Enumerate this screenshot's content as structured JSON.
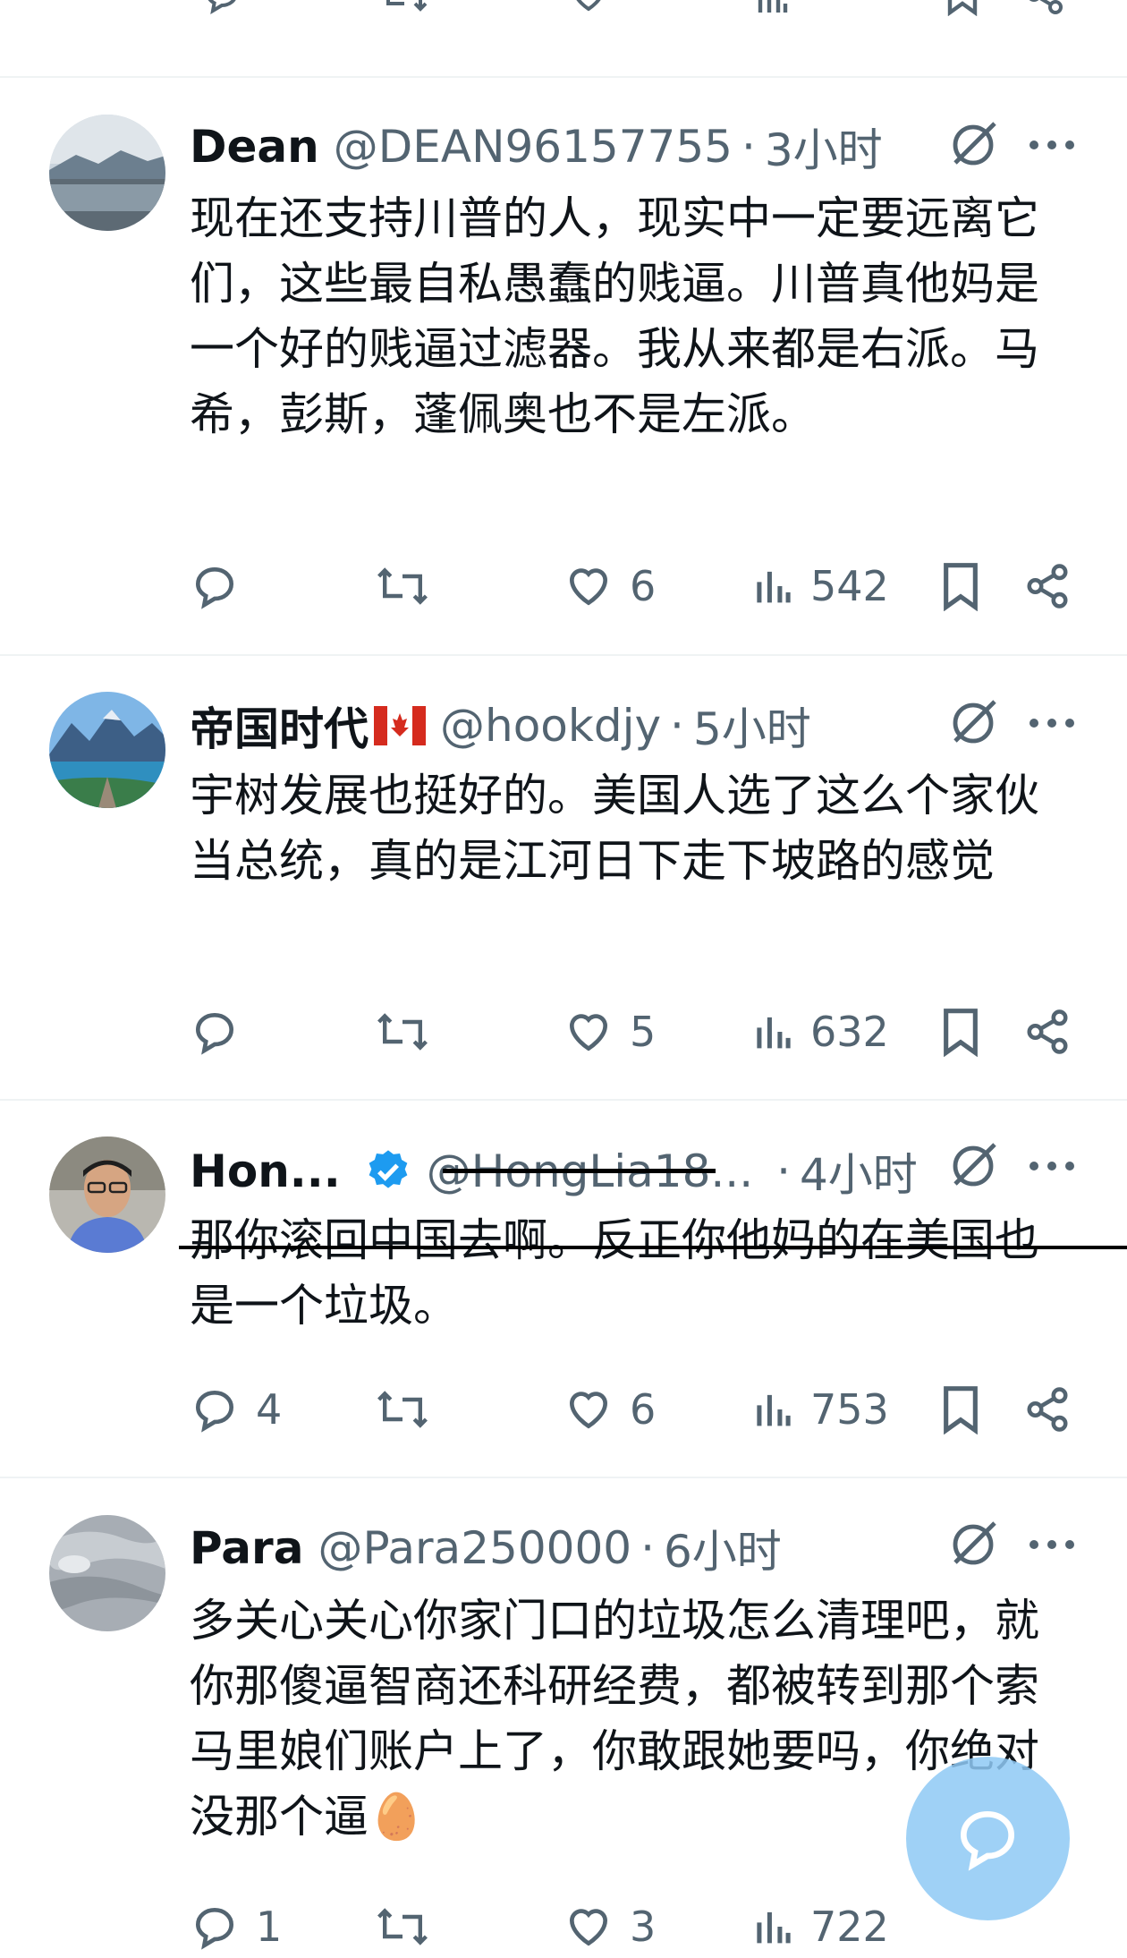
{
  "tweets": [
    {
      "name": "Dean",
      "handle": "@DEAN96157755",
      "dot": "·",
      "time": "3小时",
      "text": "现在还支持川普的人，现实中一定要远离它们，这些最自私愚蠢的贱逼。川普真他妈是一个好的贱逼过滤器。我从来都是右派。马希，彭斯，蓬佩奥也不是左派。",
      "replies": "",
      "likes": "6",
      "views": "542"
    },
    {
      "name": "帝国时代",
      "handle": "@hookdjy",
      "dot": "·",
      "time": "5小时",
      "text": "宇树发展也挺好的。美国人选了这么个家伙当总统，真的是江河日下走下坡路的感觉",
      "replies": "",
      "likes": "5",
      "views": "632"
    },
    {
      "name": "Hon...",
      "handle": "@HongLia18...",
      "dot": "·",
      "time": "4小时",
      "text": "那你滚回中国去啊。反正你他妈的在美国也是一个垃圾。",
      "replies": "4",
      "likes": "6",
      "views": "753"
    },
    {
      "name": "Para",
      "handle": "@Para250000",
      "dot": "·",
      "time": "6小时",
      "text": "多关心关心你家门口的垃圾怎么清理吧，就你那傻逼智商还科研经费，都被转到那个索马里娘们账户上了，你敢跟她要吗，你绝对没那个逼🥚",
      "replies": "1",
      "likes": "3",
      "views": "722"
    }
  ],
  "colors": {
    "text": "#0f1419",
    "secondary": "#536471",
    "divider": "#eff3f4",
    "verified": "#1d9bf0",
    "fab": "#8fcaf5"
  },
  "icons": [
    "reply-icon",
    "retweet-icon",
    "like-icon",
    "views-icon",
    "bookmark-icon",
    "share-icon",
    "grok-icon",
    "more-icon",
    "verified-icon",
    "flag-canada-icon",
    "compose-message-icon"
  ]
}
